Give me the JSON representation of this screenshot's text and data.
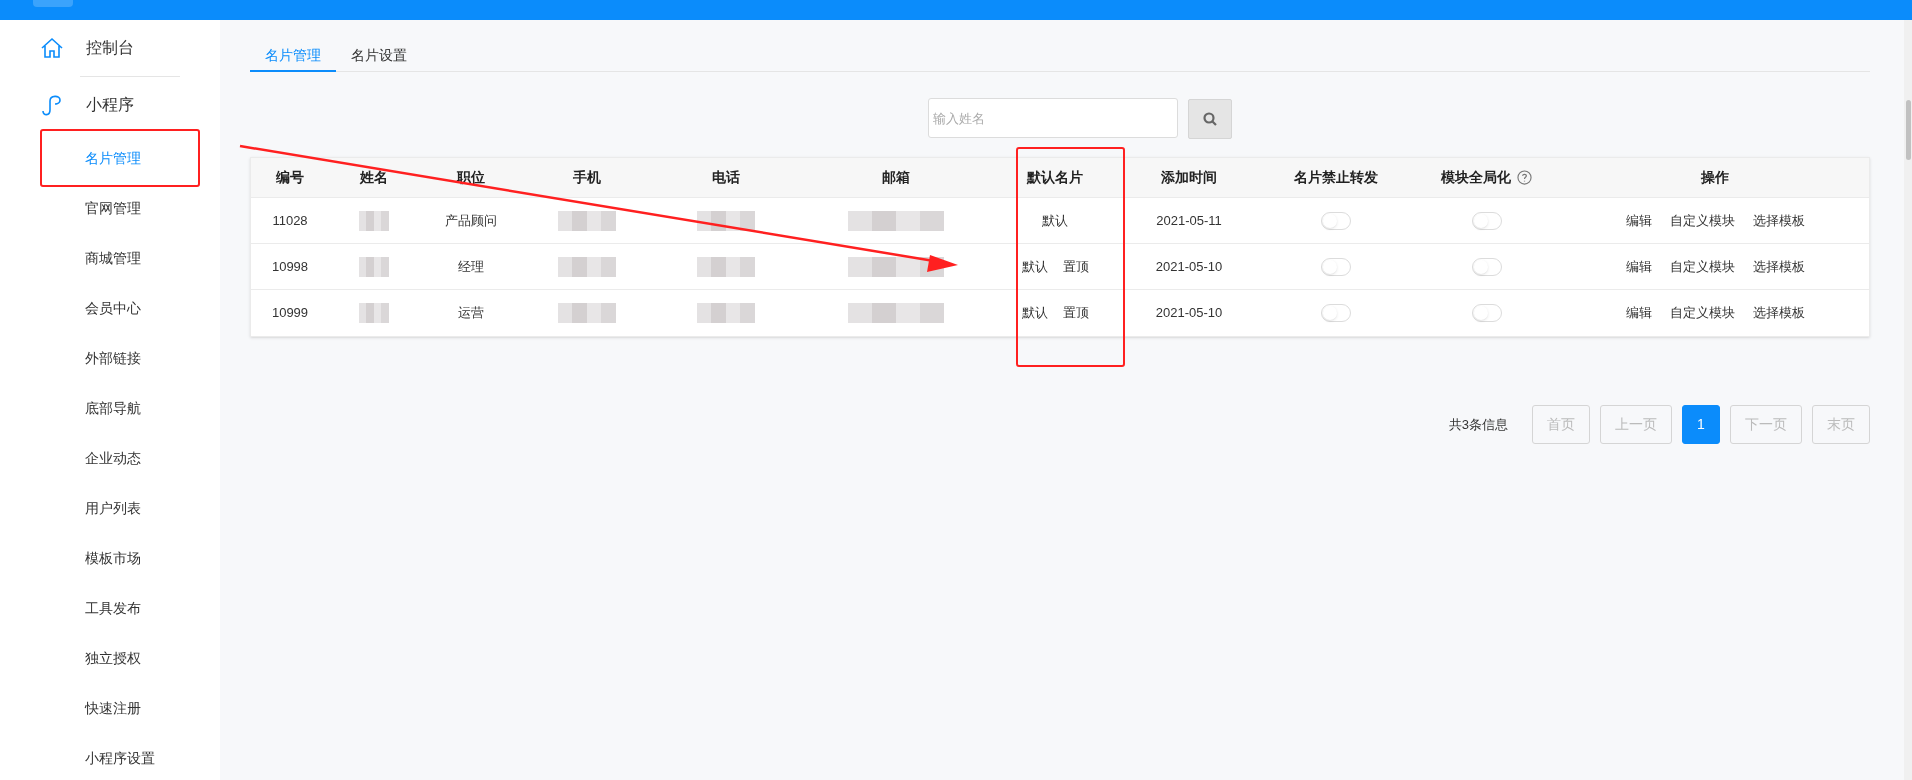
{
  "sidebar": {
    "sections": [
      {
        "label": "控制台",
        "selected": false
      },
      {
        "label": "小程序",
        "selected": false,
        "children": [
          {
            "label": "名片管理",
            "selected": true
          },
          {
            "label": "官网管理",
            "selected": false
          },
          {
            "label": "商城管理",
            "selected": false
          },
          {
            "label": "会员中心",
            "selected": false
          },
          {
            "label": "外部链接",
            "selected": false
          },
          {
            "label": "底部导航",
            "selected": false
          },
          {
            "label": "企业动态",
            "selected": false
          },
          {
            "label": "用户列表",
            "selected": false
          },
          {
            "label": "模板市场",
            "selected": false
          },
          {
            "label": "工具发布",
            "selected": false
          },
          {
            "label": "独立授权",
            "selected": false
          },
          {
            "label": "快速注册",
            "selected": false
          },
          {
            "label": "小程序设置",
            "selected": false
          }
        ]
      }
    ]
  },
  "tabs": [
    {
      "label": "名片管理",
      "selected": true
    },
    {
      "label": "名片设置",
      "selected": false
    }
  ],
  "search": {
    "placeholder": "输入姓名"
  },
  "table": {
    "columns": [
      {
        "label": "编号"
      },
      {
        "label": "姓名"
      },
      {
        "label": "职位"
      },
      {
        "label": "手机"
      },
      {
        "label": "电话"
      },
      {
        "label": "邮箱"
      },
      {
        "label": "默认名片"
      },
      {
        "label": "添加时间"
      },
      {
        "label": "名片禁止转发"
      },
      {
        "label": "模块全局化",
        "help": true
      },
      {
        "label": "操作"
      }
    ],
    "rows": [
      {
        "id": "11028",
        "position": "产品顾问",
        "default_actions": [
          "默认"
        ],
        "added": "2021-05-11",
        "forward_disabled": {
          "on": false
        },
        "global_module": {
          "on": false
        },
        "actions": [
          "编辑",
          "自定义模块",
          "选择模板"
        ]
      },
      {
        "id": "10998",
        "position": "经理",
        "default_actions": [
          "默认",
          "置顶"
        ],
        "added": "2021-05-10",
        "forward_disabled": {
          "on": false
        },
        "global_module": {
          "on": false
        },
        "actions": [
          "编辑",
          "自定义模块",
          "选择模板"
        ]
      },
      {
        "id": "10999",
        "position": "运营",
        "default_actions": [
          "默认",
          "置顶"
        ],
        "added": "2021-05-10",
        "forward_disabled": {
          "on": false
        },
        "global_module": {
          "on": false
        },
        "actions": [
          "编辑",
          "自定义模块",
          "选择模板"
        ]
      }
    ]
  },
  "pagination": {
    "summary": "共3条信息",
    "buttons": [
      {
        "label": "首页",
        "selected": false
      },
      {
        "label": "上一页",
        "selected": false
      },
      {
        "label": "1",
        "selected": true
      },
      {
        "label": "下一页",
        "selected": false
      },
      {
        "label": "末页",
        "selected": false
      }
    ]
  }
}
